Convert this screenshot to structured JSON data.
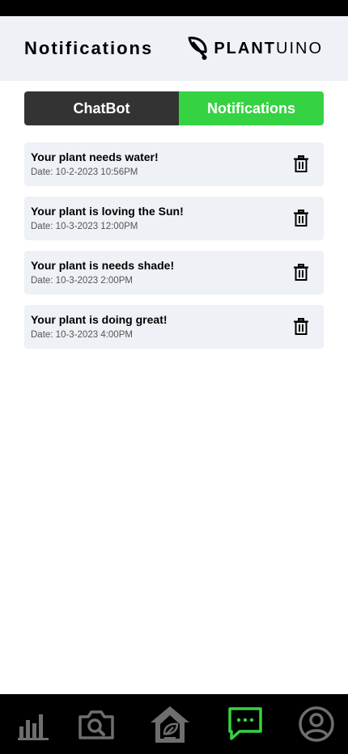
{
  "header": {
    "title": "Notifications",
    "brand_strong": "PLANT",
    "brand_light": "UINO"
  },
  "tabs": [
    {
      "label": "ChatBot",
      "active": false
    },
    {
      "label": "Notifications",
      "active": true
    }
  ],
  "notifications": [
    {
      "title": "Your plant needs water!",
      "date": "Date: 10-2-2023 10:56PM"
    },
    {
      "title": "Your plant is loving the Sun!",
      "date": "Date: 10-3-2023 12:00PM"
    },
    {
      "title": "Your plant is needs shade!",
      "date": "Date: 10-3-2023 2:00PM"
    },
    {
      "title": "Your plant is doing great!",
      "date": "Date: 10-3-2023 4:00PM"
    }
  ],
  "bottom_nav": [
    {
      "icon": "bar-chart-icon",
      "active": false
    },
    {
      "icon": "camera-search-icon",
      "active": false
    },
    {
      "icon": "home-leaf-icon",
      "active": false
    },
    {
      "icon": "chat-bubble-icon",
      "active": true
    },
    {
      "icon": "user-profile-icon",
      "active": false
    }
  ],
  "colors": {
    "accent": "#35d342",
    "dark_segment": "#333333",
    "header_bg": "#eef1f5",
    "card_bg": "#eef1f5",
    "nav_bg": "#000000",
    "nav_icon_inactive": "#6e6e6e"
  }
}
